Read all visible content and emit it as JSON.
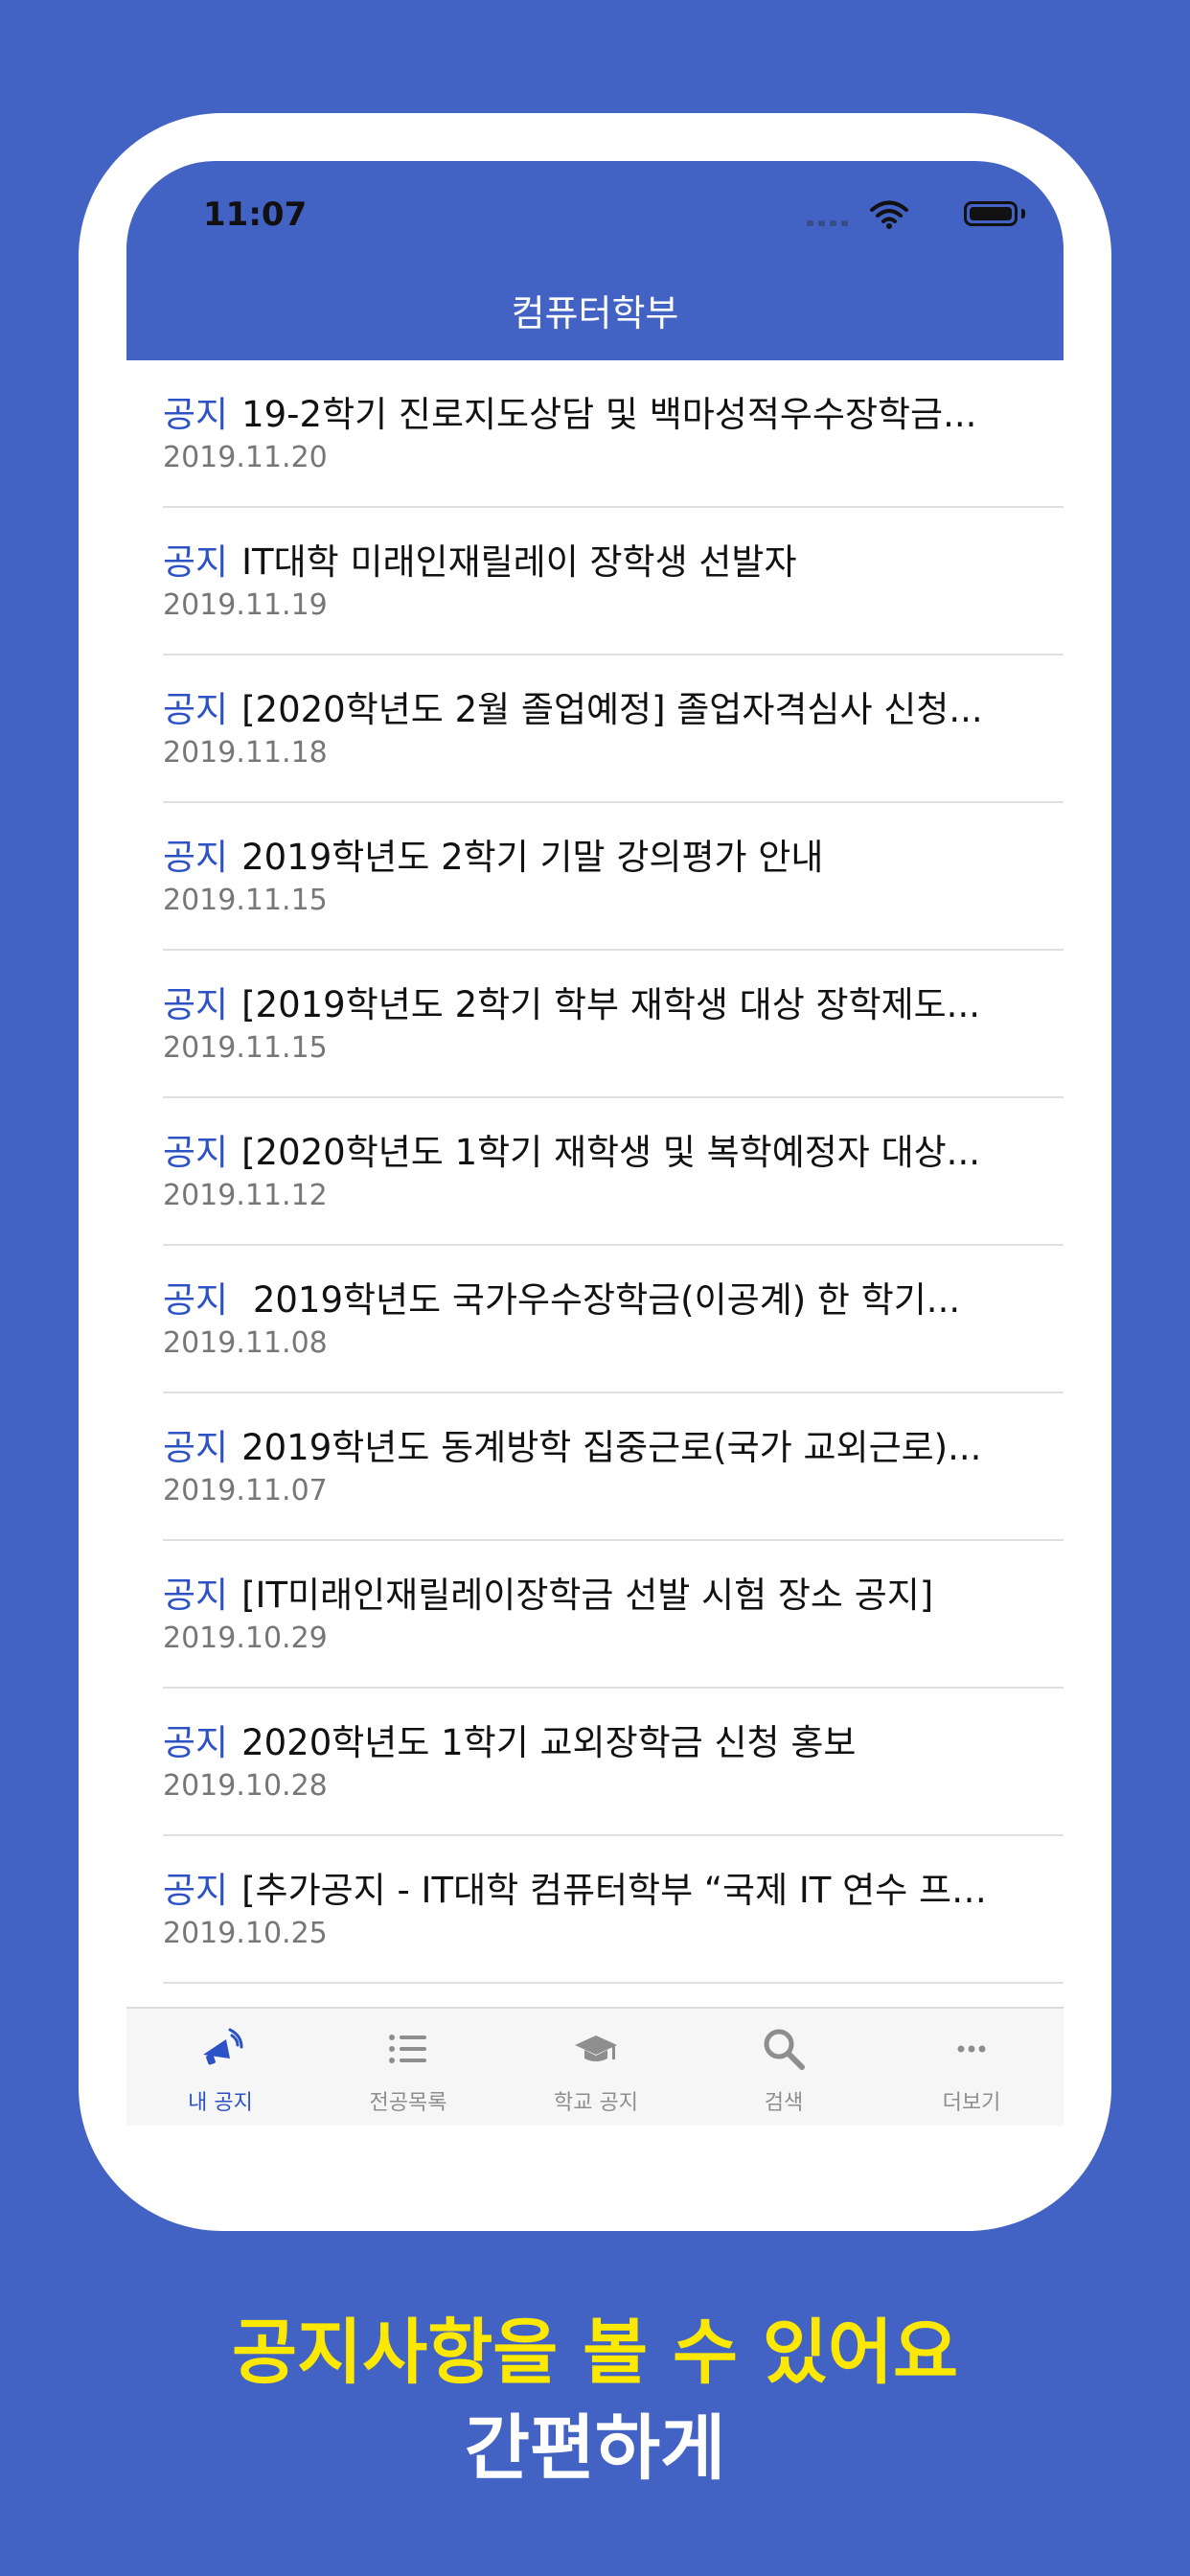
{
  "status": {
    "time": "11:07"
  },
  "header": {
    "title": "컴퓨터학부"
  },
  "notices": [
    {
      "tag": "공지",
      "title": "19-2학기 진로지도상담 및 백마성적우수장학금...",
      "date": "2019.11.20"
    },
    {
      "tag": "공지",
      "title": "IT대학 미래인재릴레이 장학생 선발자",
      "date": "2019.11.19"
    },
    {
      "tag": "공지",
      "title": "[2020학년도 2월 졸업예정] 졸업자격심사 신청...",
      "date": "2019.11.18"
    },
    {
      "tag": "공지",
      "title": "2019학년도 2학기 기말 강의평가 안내",
      "date": "2019.11.15"
    },
    {
      "tag": "공지",
      "title": "[2019학년도 2학기 학부 재학생 대상 장학제도...",
      "date": "2019.11.15"
    },
    {
      "tag": "공지",
      "title": "[2020학년도 1학기 재학생 및 복학예정자 대상...",
      "date": "2019.11.12"
    },
    {
      "tag": "공지",
      "title": " 2019학년도 국가우수장학금(이공계) 한 학기...",
      "date": "2019.11.08"
    },
    {
      "tag": "공지",
      "title": "2019학년도 동계방학 집중근로(국가 교외근로)...",
      "date": "2019.11.07"
    },
    {
      "tag": "공지",
      "title": "[IT미래인재릴레이장학금 선발 시험 장소 공지]",
      "date": "2019.10.29"
    },
    {
      "tag": "공지",
      "title": "2020학년도 1학기 교외장학금 신청 홍보",
      "date": "2019.10.28"
    },
    {
      "tag": "공지",
      "title": "[추가공지 - IT대학 컴퓨터학부 “국제 IT 연수 프…",
      "date": "2019.10.25"
    }
  ],
  "tabs": [
    {
      "label": "내 공지",
      "icon": "megaphone-icon",
      "active": true
    },
    {
      "label": "전공목록",
      "icon": "list-icon",
      "active": false
    },
    {
      "label": "학교 공지",
      "icon": "graduation-cap-icon",
      "active": false
    },
    {
      "label": "검색",
      "icon": "search-icon",
      "active": false
    },
    {
      "label": "더보기",
      "icon": "more-icon",
      "active": false
    }
  ],
  "caption": {
    "line1": "공지사항을 볼 수 있어요",
    "line2": "간편하게"
  },
  "colors": {
    "background": "#4363c4",
    "accent": "#2d52c6",
    "caption_highlight": "#fce800"
  }
}
